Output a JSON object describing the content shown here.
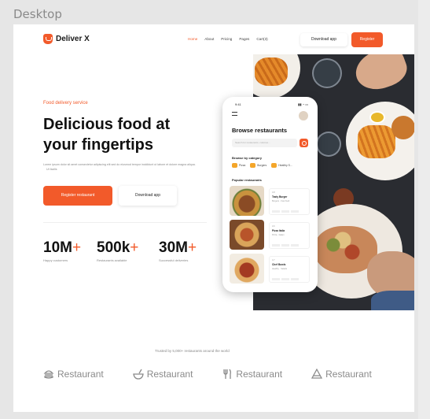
{
  "frame_label": "Desktop",
  "nav": {
    "brand": "Deliver X",
    "links": [
      "Home",
      "About",
      "Pricing",
      "Pages",
      "Cart(3)"
    ],
    "download_label": "Download app",
    "register_label": "Register"
  },
  "hero": {
    "eyebrow": "Food delivery service",
    "headline": "Delicious food at your fingertips",
    "desc": "Lorem ipsum dolor sit amet consectetur adipiscing elit sed do eiusmod tempor incididunt ut labore et dolore magna aliqua.",
    "desc_tail": "Ut facilis",
    "primary_button": "Register restaurant",
    "secondary_button": "Download app"
  },
  "stats": [
    {
      "value": "10M",
      "suffix": "+",
      "label": "Happy customers"
    },
    {
      "value": "500k",
      "suffix": "+",
      "label": "Restaurants available"
    },
    {
      "value": "30M",
      "suffix": "+",
      "label": "Successful deliveries"
    }
  ],
  "phone": {
    "time": "9:41",
    "status": "▮▮ ◔ ▭",
    "title": "Browse restaurants",
    "search_placeholder": "Search for restaurants, cuisines...",
    "category_header": "Browse by category",
    "categories": [
      "Pizza",
      "Burgers",
      "Healthy S..."
    ],
    "popular_header": "Popular restaurants",
    "cards": [
      {
        "rating": "4.8",
        "name": "Tasty Burger",
        "meta": "Burgers · Fast food"
      },
      {
        "rating": "4.6",
        "name": "Pizza Italia",
        "meta": "Pizza · Italian"
      },
      {
        "rating": "4.7",
        "name": "Chef Bowls",
        "meta": "Healthy · Salads"
      }
    ]
  },
  "trusted_text": "Trusted by 5,000+ restaurants around the world",
  "partners": [
    "Restaurant",
    "Restaurant",
    "Restaurant",
    "Restaurant"
  ],
  "colors": {
    "accent": "#f25a2a",
    "text": "#111111",
    "muted": "#888888"
  }
}
